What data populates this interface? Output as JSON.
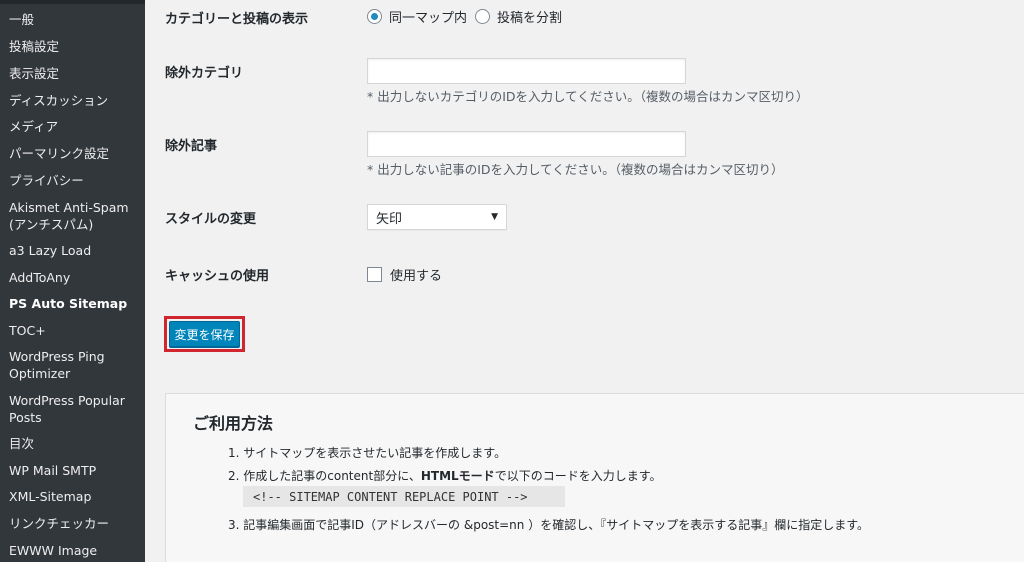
{
  "sidebar": {
    "items": [
      {
        "label": "一般"
      },
      {
        "label": "投稿設定"
      },
      {
        "label": "表示設定"
      },
      {
        "label": "ディスカッション"
      },
      {
        "label": "メディア"
      },
      {
        "label": "パーマリンク設定"
      },
      {
        "label": "プライバシー"
      },
      {
        "label": "Akismet Anti-Spam (アンチスパム)"
      },
      {
        "label": "a3 Lazy Load"
      },
      {
        "label": "AddToAny"
      },
      {
        "label": "PS Auto Sitemap"
      },
      {
        "label": "TOC+"
      },
      {
        "label": "WordPress Ping Optimizer"
      },
      {
        "label": "WordPress Popular Posts"
      },
      {
        "label": "目次"
      },
      {
        "label": "WP Mail SMTP"
      },
      {
        "label": "XML-Sitemap"
      },
      {
        "label": "リンクチェッカー"
      },
      {
        "label": "EWWW Image"
      }
    ],
    "active": "PS Auto Sitemap"
  },
  "settings": {
    "category_display": {
      "label": "カテゴリーと投稿の表示",
      "options": [
        {
          "label": "同一マップ内",
          "selected": true
        },
        {
          "label": "投稿を分割",
          "selected": false
        }
      ]
    },
    "exclude_category": {
      "label": "除外カテゴリ",
      "value": "",
      "hint": "* 出力しないカテゴリのIDを入力してください。（複数の場合はカンマ区切り）"
    },
    "exclude_post": {
      "label": "除外記事",
      "value": "",
      "hint": "* 出力しない記事のIDを入力してください。（複数の場合はカンマ区切り）"
    },
    "style": {
      "label": "スタイルの変更",
      "selected": "矢印"
    },
    "cache": {
      "label": "キャッシュの使用",
      "checkbox_label": "使用する",
      "checked": false
    },
    "save_label": "変更を保存"
  },
  "usage": {
    "title": "ご利用方法",
    "step1": "1. サイトマップを表示させたい記事を作成します。",
    "step2_pre": "2. 作成した記事のcontent部分に、",
    "step2_bold": "HTMLモード",
    "step2_post": "で以下のコードを入力します。",
    "code": "<!-- SITEMAP CONTENT REPLACE POINT -->",
    "step3": "3. 記事編集画面で記事ID（アドレスバーの &post=nn ）を確認し、『サイトマップを表示する記事』欄に指定します。"
  },
  "colors": {
    "sidebar_bg": "#32373c",
    "primary_button": "#0085ba",
    "highlight_border": "#d1252f"
  }
}
